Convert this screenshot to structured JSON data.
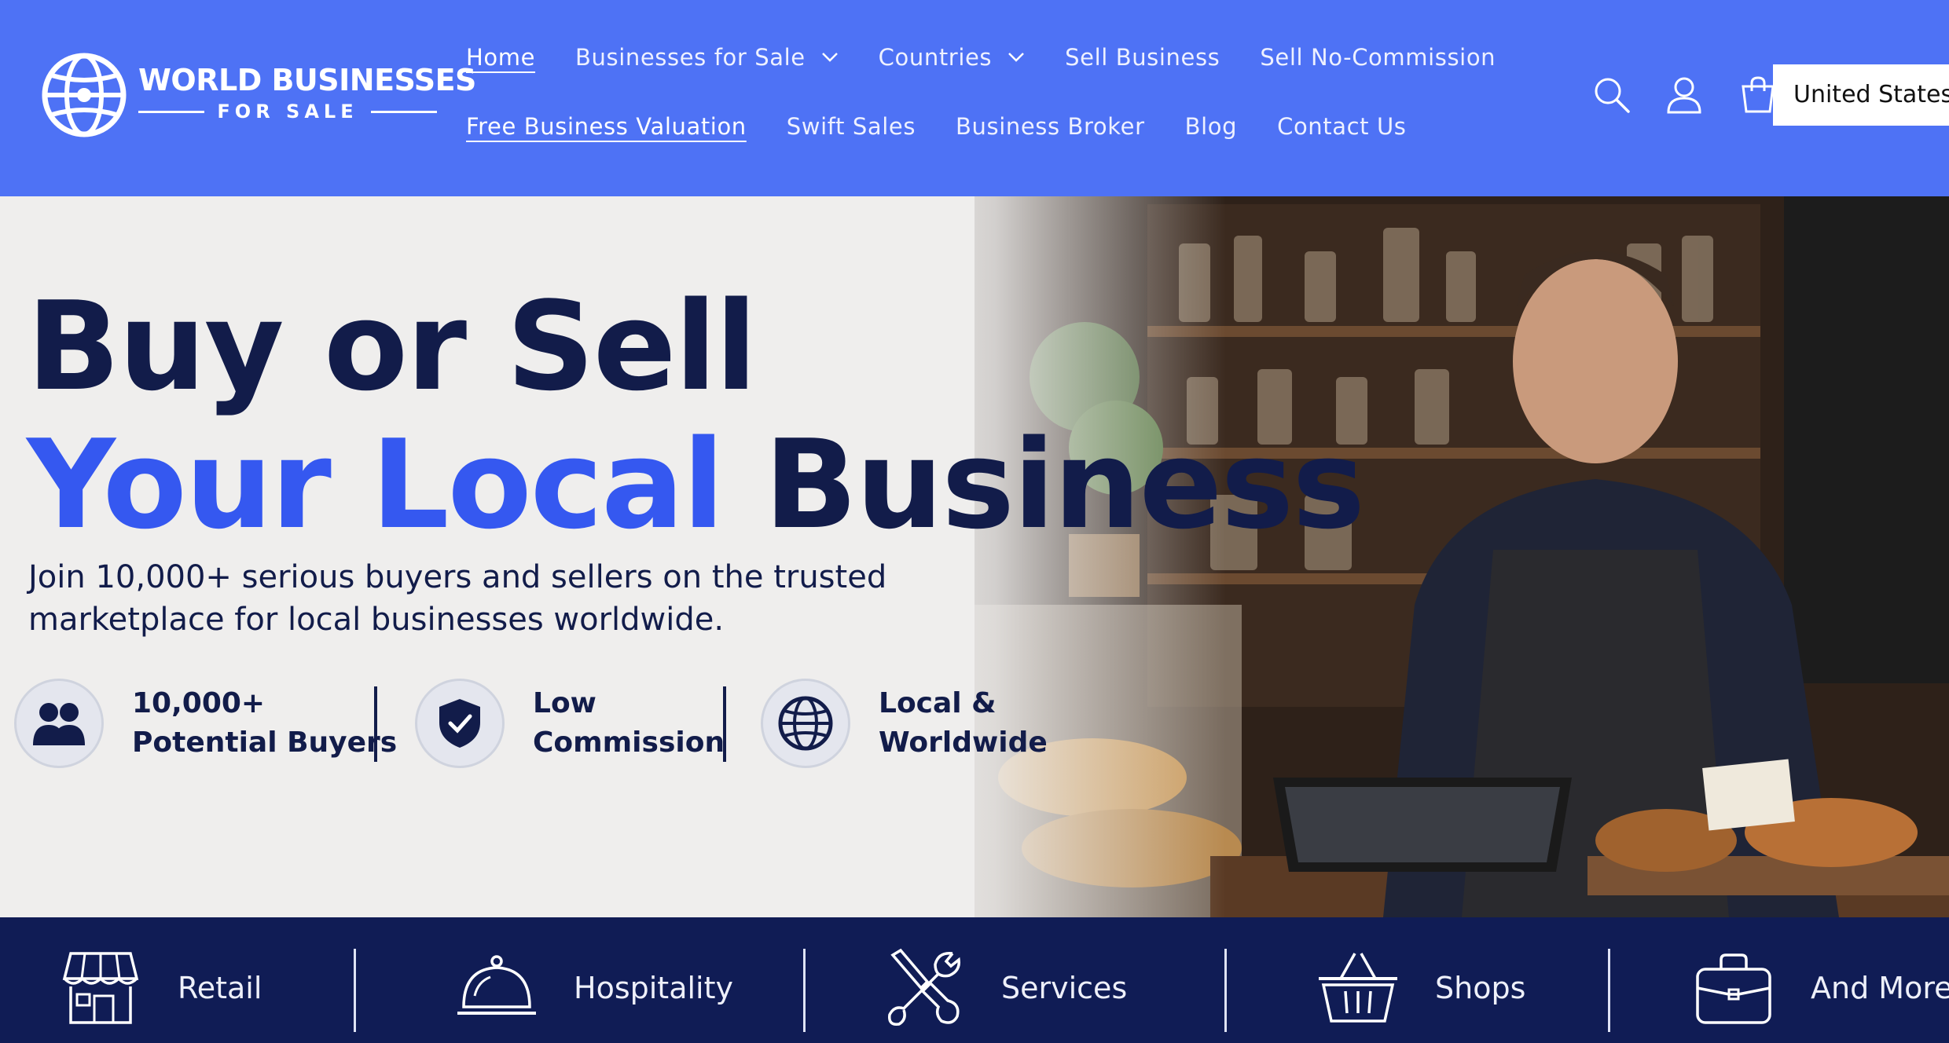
{
  "brand": {
    "name_line1": "WORLD BUSINESSES",
    "name_line2": "FOR SALE",
    "logo_icon": "globe-icon"
  },
  "nav": {
    "row1": [
      {
        "label": "Home",
        "active": true,
        "dropdown": false
      },
      {
        "label": "Businesses for Sale",
        "active": false,
        "dropdown": true
      },
      {
        "label": "Countries",
        "active": false,
        "dropdown": true
      },
      {
        "label": "Sell Business",
        "active": false,
        "dropdown": false
      },
      {
        "label": "Sell No-Commission",
        "active": false,
        "dropdown": false
      }
    ],
    "row2": [
      {
        "label": "Free Business Valuation",
        "active": true,
        "dropdown": false
      },
      {
        "label": "Swift Sales",
        "active": false,
        "dropdown": false
      },
      {
        "label": "Business Broker",
        "active": false,
        "dropdown": false
      },
      {
        "label": "Blog",
        "active": false,
        "dropdown": false
      },
      {
        "label": "Contact Us",
        "active": false,
        "dropdown": false
      }
    ]
  },
  "header_icons": [
    "search-icon",
    "account-icon",
    "cart-icon"
  ],
  "country_selector": "United States",
  "hero": {
    "headline_line1": "Buy or Sell",
    "headline_line2_blue": "Your Local",
    "headline_line2_dark": "Business",
    "subheadline": "Join 10,000+ serious buyers and sellers on the trusted marketplace for local businesses worldwide.",
    "features": [
      {
        "icon": "users-icon",
        "line1": "10,000+",
        "line2": "Potential Buyers"
      },
      {
        "icon": "shield-check-icon",
        "line1": "Low",
        "line2": "Commission"
      },
      {
        "icon": "globe-icon",
        "line1": "Local &",
        "line2": "Worldwide"
      }
    ]
  },
  "categories": [
    {
      "label": "Retail",
      "icon": "storefront-icon"
    },
    {
      "label": "Hospitality",
      "icon": "cloche-icon"
    },
    {
      "label": "Services",
      "icon": "tools-icon"
    },
    {
      "label": "Shops",
      "icon": "basket-icon"
    },
    {
      "label": "And More",
      "icon": "briefcase-icon"
    }
  ],
  "colors": {
    "header_bg": "#4e72f5",
    "headline_dark": "#121c4a",
    "headline_blue": "#3558f0",
    "category_bar_bg": "#101c55"
  }
}
